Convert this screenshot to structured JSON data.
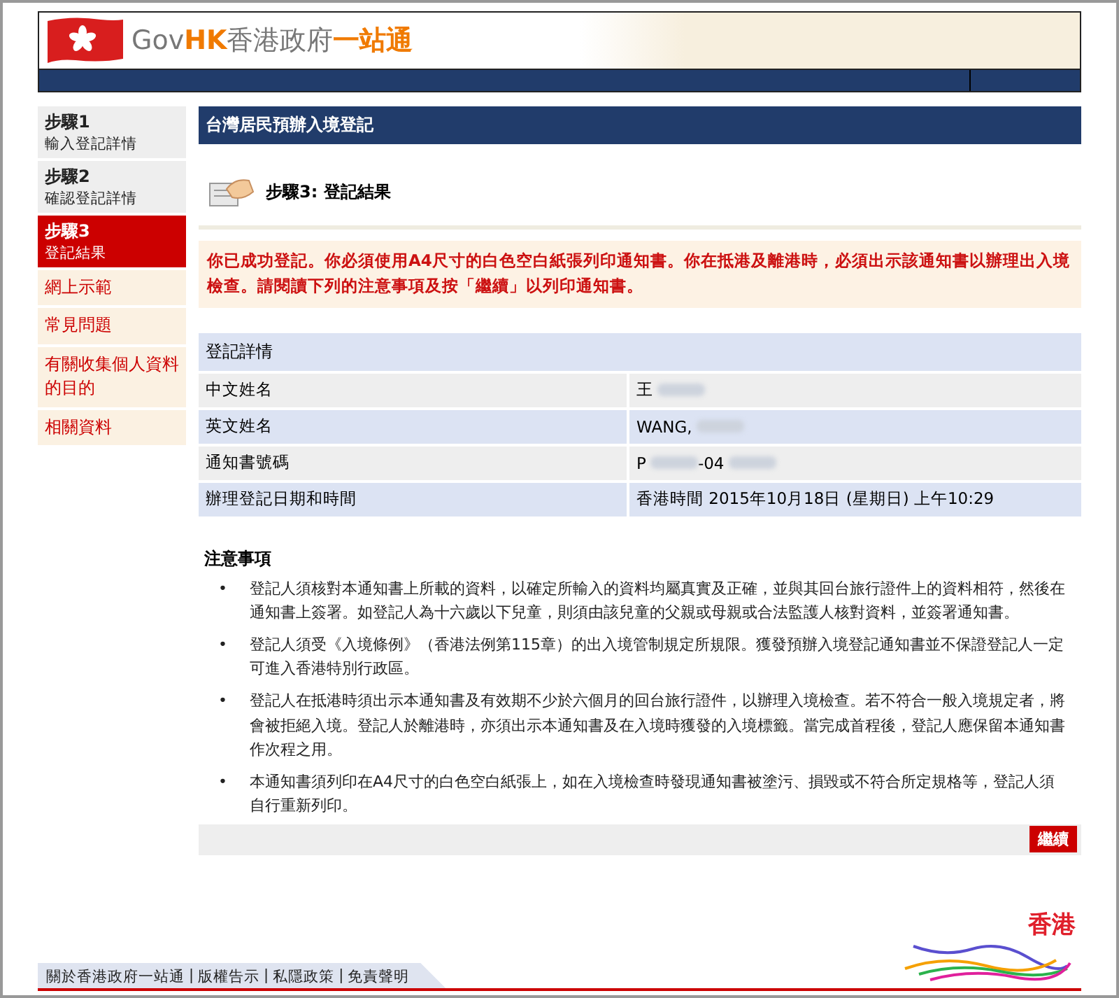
{
  "header": {
    "brand": [
      {
        "text": "Gov",
        "accent": false
      },
      {
        "text": "HK",
        "accent": true
      },
      {
        "text": "香港政府",
        "accent": false
      },
      {
        "text": "一站通",
        "accent": true
      }
    ]
  },
  "sidebar": {
    "items": [
      {
        "kind": "step",
        "title": "步驟1",
        "subtitle": "輸入登記詳情",
        "selected": false
      },
      {
        "kind": "step",
        "title": "步驟2",
        "subtitle": "確認登記詳情",
        "selected": false
      },
      {
        "kind": "step",
        "title": "步驟3",
        "subtitle": "登記結果",
        "selected": true
      },
      {
        "kind": "link",
        "label": "網上示範"
      },
      {
        "kind": "link",
        "label": "常見問題"
      },
      {
        "kind": "link",
        "label": "有關收集個人資料的目的"
      },
      {
        "kind": "link",
        "label": "相關資料"
      }
    ]
  },
  "page_title": "台灣居民預辦入境登記",
  "step_heading": "步驟3: 登記結果",
  "notice": "你已成功登記。你必須使用A4尺寸的白色空白紙張列印通知書。你在抵港及離港時，必須出示該通知書以辦理出入境檢查。請閱讀下列的注意事項及按「繼續」以列印通知書。",
  "details": {
    "title": "登記詳情",
    "rows": [
      {
        "label": "中文姓名",
        "value": [
          {
            "kind": "text",
            "text": "王"
          },
          {
            "kind": "blurred"
          }
        ]
      },
      {
        "label": "英文姓名",
        "value": [
          {
            "kind": "text",
            "text": "WANG,"
          },
          {
            "kind": "blurred"
          }
        ]
      },
      {
        "label": "通知書號碼",
        "value": [
          {
            "kind": "text",
            "text": "P"
          },
          {
            "kind": "blurred"
          },
          {
            "kind": "text",
            "text": "-04"
          },
          {
            "kind": "blurred"
          }
        ]
      },
      {
        "label": "辦理登記日期和時間",
        "value": [
          {
            "kind": "text",
            "text": "香港時間 2015年10月18日 (星期日) 上午10:29"
          }
        ]
      }
    ]
  },
  "notes": {
    "title": "注意事項",
    "bullet": "•",
    "items": [
      "登記人須核對本通知書上所載的資料，以確定所輸入的資料均屬真實及正確，並與其回台旅行證件上的資料相符，然後在通知書上簽署。如登記人為十六歲以下兒童，則須由該兒童的父親或母親或合法監護人核對資料，並簽署通知書。",
      "登記人須受《入境條例》（香港法例第115章）的出入境管制規定所規限。獲發預辦入境登記通知書並不保證登記人一定可進入香港特別行政區。",
      "登記人在抵港時須出示本通知書及有效期不少於六個月的回台旅行證件，以辦理入境檢查。若不符合一般入境規定者，將會被拒絕入境。登記人於離港時，亦須出示本通知書及在入境時獲發的入境標籤。當完成首程後，登記人應保留本通知書作次程之用。",
      "本通知書須列印在A4尺寸的白色空白紙張上，如在入境檢查時發現通知書被塗污、損毀或不符合所定規格等，登記人須自行重新列印。"
    ]
  },
  "continue_button": "繼續",
  "footer": {
    "links": [
      "關於香港政府一站通",
      "版權告示",
      "私隱政策",
      "免責聲明"
    ],
    "separator": "|",
    "brand_logo": "香港"
  }
}
